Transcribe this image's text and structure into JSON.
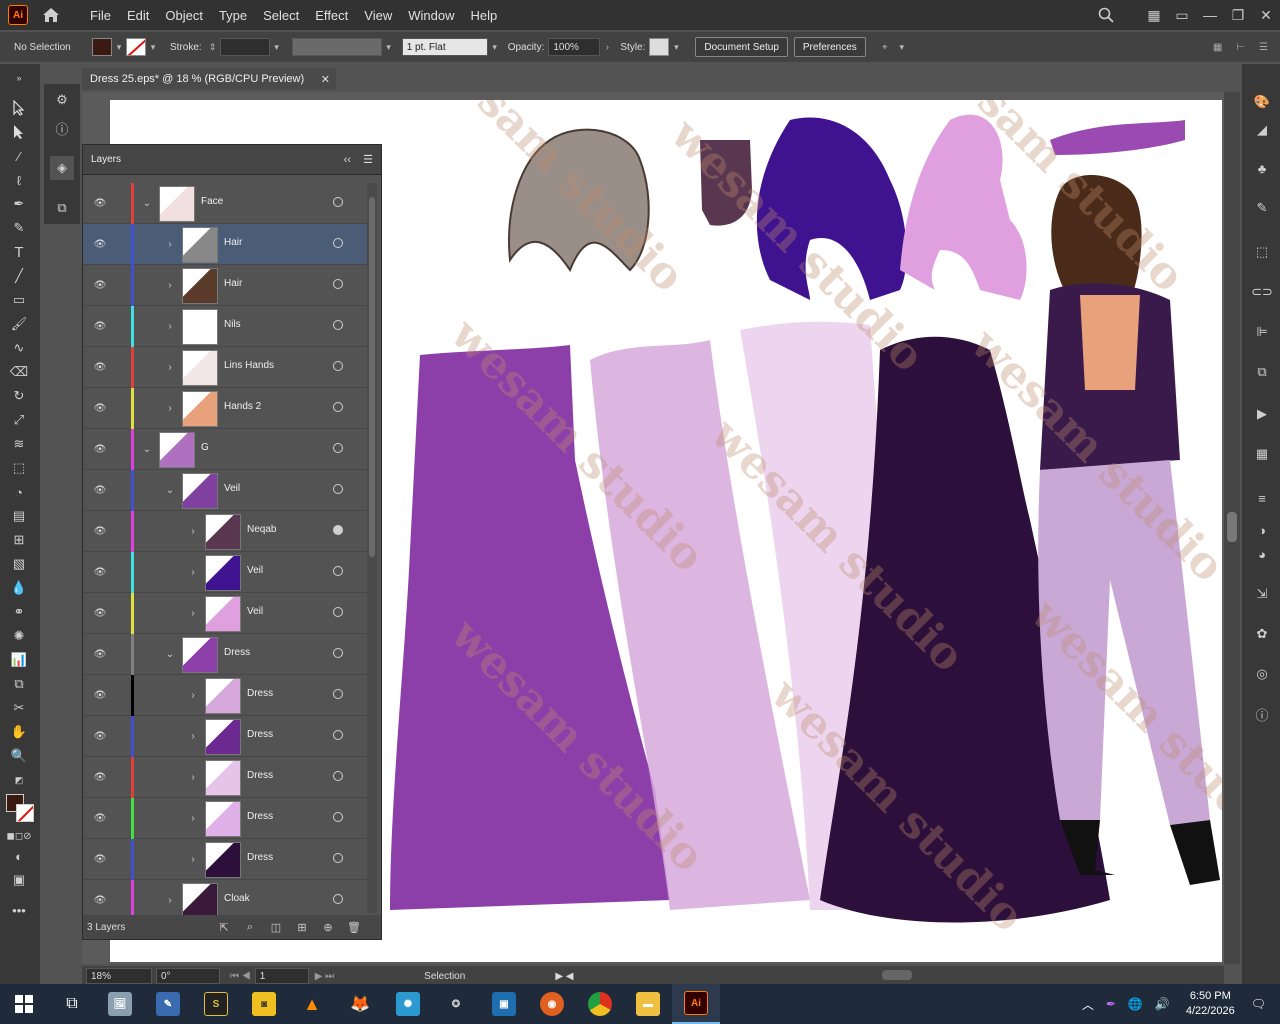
{
  "menubar": {
    "app_logo": "Ai",
    "menus": [
      "File",
      "Edit",
      "Object",
      "Type",
      "Select",
      "Effect",
      "View",
      "Window",
      "Help"
    ]
  },
  "controlbar": {
    "selection_state": "No Selection",
    "stroke_label": "Stroke:",
    "brush_value": "1 pt. Flat",
    "opacity_label": "Opacity:",
    "opacity_value": "100%",
    "style_label": "Style:",
    "document_setup": "Document Setup",
    "preferences": "Preferences",
    "fill_color": "#3b1a12"
  },
  "document": {
    "tab_title": "Dress 25.eps* @ 18 % (RGB/CPU Preview)"
  },
  "layers_panel": {
    "title": "Layers",
    "rows": [
      {
        "name": "Face",
        "color": "#e0403a",
        "expanded": true,
        "target_filled": false
      },
      {
        "name": "Hair",
        "color": "#4050d0",
        "expanded": false,
        "target_filled": false
      },
      {
        "name": "Hair",
        "color": "#4050d0",
        "expanded": false,
        "target_filled": false
      },
      {
        "name": "Nils",
        "color": "#40e0e0",
        "expanded": false,
        "target_filled": false
      },
      {
        "name": "Lins Hands",
        "color": "#e0403a",
        "expanded": false,
        "target_filled": false
      },
      {
        "name": "Hands 2",
        "color": "#e0e040",
        "expanded": false,
        "target_filled": false
      },
      {
        "name": "G",
        "color": "#e040e0",
        "expanded": true,
        "target_filled": false
      },
      {
        "name": "Veil",
        "color": "#4050d0",
        "expanded": true,
        "target_filled": false
      },
      {
        "name": "Neqab",
        "color": "#e040e0",
        "expanded": false,
        "target_filled": true
      },
      {
        "name": "Veil",
        "color": "#40e0e0",
        "expanded": false,
        "target_filled": false
      },
      {
        "name": "Veil",
        "color": "#e0e040",
        "expanded": false,
        "target_filled": false
      },
      {
        "name": "Dress",
        "color": "#808080",
        "expanded": true,
        "target_filled": false
      },
      {
        "name": "Dress",
        "color": "#000000",
        "expanded": false,
        "target_filled": false
      },
      {
        "name": "Dress",
        "color": "#4050d0",
        "expanded": false,
        "target_filled": false
      },
      {
        "name": "Dress",
        "color": "#e0403a",
        "expanded": false,
        "target_filled": false
      },
      {
        "name": "Dress",
        "color": "#40e040",
        "expanded": false,
        "target_filled": false
      },
      {
        "name": "Dress",
        "color": "#4050d0",
        "expanded": false,
        "target_filled": false
      },
      {
        "name": "Cloak",
        "color": "#e040e0",
        "expanded": false,
        "target_filled": false
      }
    ],
    "footer_count": "3 Layers"
  },
  "statusbar": {
    "zoom": "18%",
    "rotation": "0°",
    "artboard": "1",
    "tool": "Selection"
  },
  "taskbar": {
    "time": "6:50 PM",
    "date": "4/22/2026"
  },
  "watermark_text": "wesam studio"
}
